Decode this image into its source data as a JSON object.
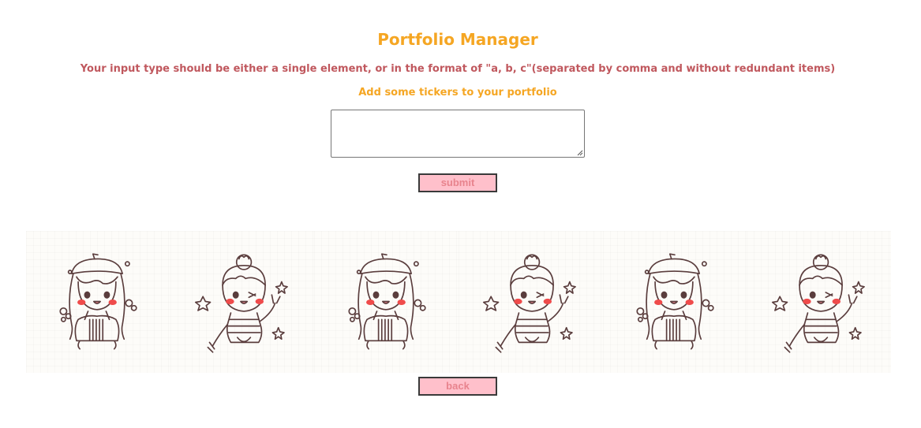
{
  "header": {
    "title": "Portfolio Manager",
    "instructions": "Your input type should be either a single element, or in the format of \"a, b, c\"(separated by comma and without redundant items)",
    "prompt": "Add some tickers to your portfolio"
  },
  "form": {
    "ticker_value": "",
    "submit_label": "submit"
  },
  "gallery": {
    "tiles": [
      {
        "icon": "girl-beret-icon"
      },
      {
        "icon": "girl-bun-peace-icon"
      },
      {
        "icon": "girl-beret-icon"
      },
      {
        "icon": "girl-bun-peace-icon"
      },
      {
        "icon": "girl-beret-icon"
      },
      {
        "icon": "girl-bun-peace-icon"
      }
    ]
  },
  "footer": {
    "back_label": "back"
  },
  "colors": {
    "title": "#f5a623",
    "instructions": "#c0585e",
    "button_bg": "#ffc0cb",
    "button_text": "#e8838d",
    "line_art": "#5a3d3d",
    "blush": "#ef4b4b"
  }
}
